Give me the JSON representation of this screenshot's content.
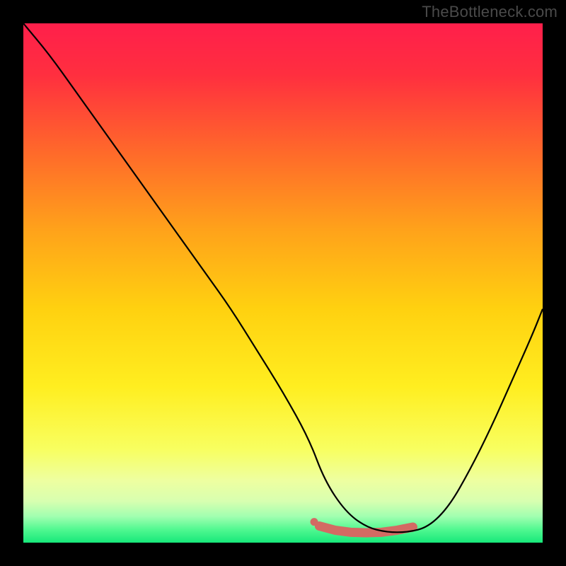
{
  "watermark": "TheBottleneck.com",
  "chart_data": {
    "type": "line",
    "title": "",
    "xlabel": "",
    "ylabel": "",
    "xlim": [
      0,
      100
    ],
    "ylim": [
      0,
      100
    ],
    "grid": false,
    "legend": false,
    "series": [
      {
        "name": "curve",
        "color": "#000000",
        "x": [
          0,
          5,
          10,
          15,
          20,
          25,
          30,
          35,
          40,
          45,
          50,
          55,
          58,
          62,
          66,
          70,
          74,
          78,
          82,
          86,
          90,
          94,
          98,
          100
        ],
        "y": [
          100,
          94,
          87,
          80,
          73,
          66,
          59,
          52,
          45,
          37,
          29,
          20,
          12,
          6,
          3,
          2,
          2,
          3,
          7,
          14,
          22,
          31,
          40,
          45
        ]
      }
    ],
    "well_region": {
      "type": "scatter",
      "color": "#d36a63",
      "x": [
        57,
        60,
        63,
        66,
        69,
        72,
        75
      ],
      "y": [
        3.2,
        2.4,
        2.0,
        1.9,
        2.0,
        2.4,
        3.0
      ]
    },
    "well_start_dot": {
      "x": 56,
      "y": 4.0,
      "color": "#d36a63"
    },
    "gradient_stops": [
      {
        "offset": 0.0,
        "color": "#ff1f4b"
      },
      {
        "offset": 0.1,
        "color": "#ff2f3f"
      },
      {
        "offset": 0.25,
        "color": "#ff6a2a"
      },
      {
        "offset": 0.4,
        "color": "#ffa31a"
      },
      {
        "offset": 0.55,
        "color": "#ffd110"
      },
      {
        "offset": 0.7,
        "color": "#ffee20"
      },
      {
        "offset": 0.82,
        "color": "#f8ff60"
      },
      {
        "offset": 0.88,
        "color": "#eeffa0"
      },
      {
        "offset": 0.92,
        "color": "#d8ffb0"
      },
      {
        "offset": 0.95,
        "color": "#a0ffb0"
      },
      {
        "offset": 0.975,
        "color": "#50f890"
      },
      {
        "offset": 1.0,
        "color": "#17e87a"
      }
    ]
  }
}
